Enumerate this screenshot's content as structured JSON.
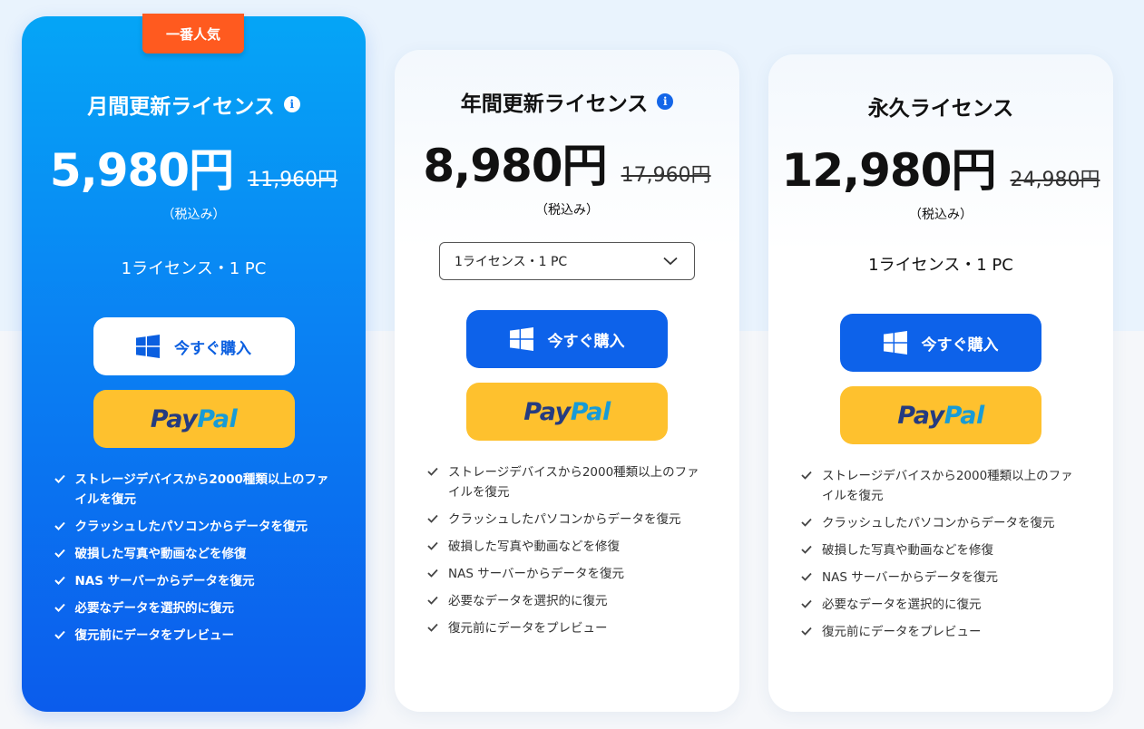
{
  "colors": {
    "featured_top": "#05a5f6",
    "featured_bottom": "#0b5cec",
    "badge": "#ff5a1f",
    "buy_blue": "#0d62ea",
    "paypal_yellow": "#fec12e",
    "paypal_dark": "#253b80",
    "paypal_light": "#179bd7"
  },
  "plans": [
    {
      "badge": "一番人気",
      "title": "月間更新ライセンス",
      "info_icon": "i",
      "price": "5,980円",
      "old_price": "11,960円",
      "tax": "（税込み）",
      "license": "1ライセンス・1 PC",
      "buy_label": "今すぐ購入",
      "paypal": [
        "Pay",
        "Pal"
      ],
      "features": [
        "ストレージデバイスから2000種類以上のファイルを復元",
        "クラッシュしたパソコンからデータを復元",
        "破損した写真や動画などを修復",
        "NAS サーバーからデータを復元",
        "必要なデータを選択的に復元",
        "復元前にデータをプレビュー"
      ]
    },
    {
      "title": "年間更新ライセンス",
      "info_icon": "i",
      "price": "8,980円",
      "old_price": "17,960円",
      "tax": "（税込み）",
      "license_select": "1ライセンス・1 PC",
      "buy_label": "今すぐ購入",
      "paypal": [
        "Pay",
        "Pal"
      ],
      "features": [
        "ストレージデバイスから2000種類以上のファイルを復元",
        "クラッシュしたパソコンからデータを復元",
        "破損した写真や動画などを修復",
        "NAS サーバーからデータを復元",
        "必要なデータを選択的に復元",
        "復元前にデータをプレビュー"
      ]
    },
    {
      "title": "永久ライセンス",
      "price": "12,980円",
      "old_price": "24,980円",
      "tax": "（税込み）",
      "license": "1ライセンス・1 PC",
      "buy_label": "今すぐ購入",
      "paypal": [
        "Pay",
        "Pal"
      ],
      "features": [
        "ストレージデバイスから2000種類以上のファイルを復元",
        "クラッシュしたパソコンからデータを復元",
        "破損した写真や動画などを修復",
        "NAS サーバーからデータを復元",
        "必要なデータを選択的に復元",
        "復元前にデータをプレビュー"
      ]
    }
  ]
}
